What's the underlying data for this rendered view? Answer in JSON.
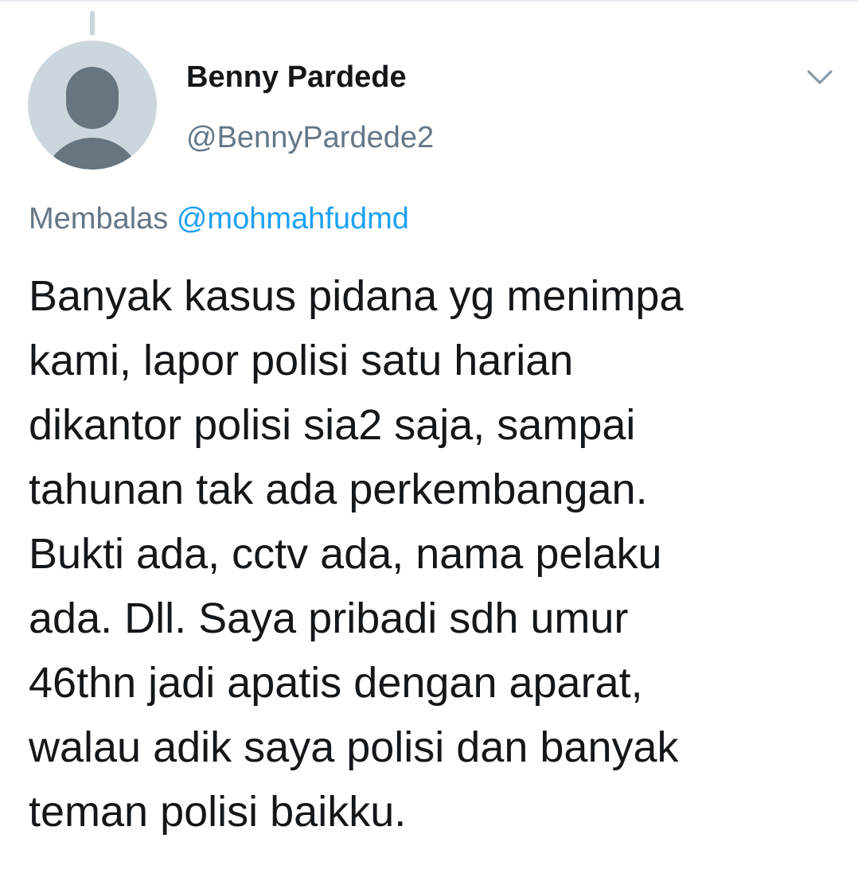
{
  "author": {
    "display_name": "Benny Pardede",
    "handle": "@BennyPardede2",
    "avatar": "default-profile-avatar"
  },
  "reply": {
    "prefix": "Membalas",
    "mention": "@mohmahfudmd"
  },
  "tweet": {
    "lines": [
      "Banyak kasus pidana yg menimpa",
      "kami, lapor polisi satu harian",
      "dikantor polisi sia2 saja, sampai",
      "tahunan tak ada perkembangan.",
      "Bukti ada, cctv ada, nama pelaku",
      "ada. Dll. Saya pribadi sdh umur",
      "46thn jadi apatis dengan aparat,",
      "walau adik saya polisi dan banyak",
      "teman polisi baikku."
    ]
  },
  "icons": {
    "menu": "chevron-down-icon"
  },
  "colors": {
    "text_primary": "#14171a",
    "text_secondary": "#657786",
    "link": "#1da1f2",
    "avatar_background": "#ccd6dd",
    "avatar_silhouette": "#66757f"
  }
}
